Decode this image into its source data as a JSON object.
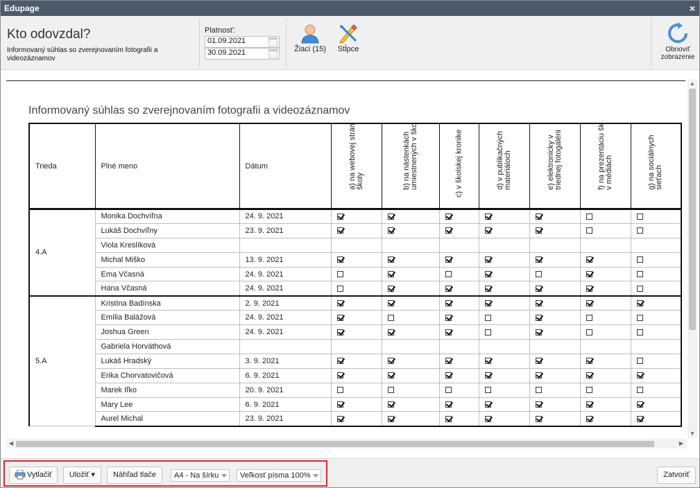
{
  "window": {
    "title": "Edupage",
    "close_glyph": "×"
  },
  "toolbar": {
    "heading": "Kto odovzdal?",
    "subheading": "Informovaný súhlas so zverejnovaním fotografii a videozáznamov",
    "validity_label": "Platnosť:",
    "date_from": "01.09.2021",
    "date_to": "30.09.2021",
    "students_label": "Žiaci (15)",
    "columns_label": "Stĺpce",
    "refresh_label_line1": "Obnoviť",
    "refresh_label_line2": "zobrazenie"
  },
  "report": {
    "title": "Informovaný súhlas so zverejnovaním fotografii a videozáznamov",
    "headers": {
      "class": "Trieda",
      "name": "Plné meno",
      "date": "Dátum",
      "consents": [
        "a) na webovej stránke školy",
        "b) na nástenkách umiestnených v škole",
        "c) v školskej kronike",
        "d) v publikačných materiáloch",
        "e) elektronicky v triednej fotogalérii",
        "f) na prezentáciu školy v médiách",
        "g) na sociálnych sieťach"
      ]
    },
    "groups": [
      {
        "class": "4.A",
        "rows": [
          {
            "name": "Monika Dochvíľna",
            "date": "24. 9. 2021",
            "checks": [
              true,
              true,
              true,
              true,
              true,
              false,
              false
            ]
          },
          {
            "name": "Lukáš Dochvíľny",
            "date": "23. 9. 2021",
            "checks": [
              true,
              true,
              true,
              true,
              true,
              false,
              false
            ]
          },
          {
            "name": "Viola Kreslíková",
            "date": "",
            "checks": null
          },
          {
            "name": "Michal Miško",
            "date": "13. 9. 2021",
            "checks": [
              true,
              true,
              true,
              true,
              true,
              true,
              false
            ]
          },
          {
            "name": "Ema Včasná",
            "date": "24. 9. 2021",
            "checks": [
              false,
              true,
              false,
              true,
              false,
              true,
              false
            ]
          },
          {
            "name": "Hana Včasná",
            "date": "24. 9. 2021",
            "checks": [
              false,
              true,
              true,
              true,
              true,
              true,
              false
            ]
          }
        ]
      },
      {
        "class": "5.A",
        "rows": [
          {
            "name": "Kristína Badínska",
            "date": "2. 9. 2021",
            "checks": [
              true,
              true,
              true,
              true,
              true,
              true,
              true
            ]
          },
          {
            "name": "Emília Balážová",
            "date": "24. 9. 2021",
            "checks": [
              true,
              false,
              true,
              false,
              true,
              false,
              false
            ]
          },
          {
            "name": "Joshua Green",
            "date": "24. 9. 2021",
            "checks": [
              true,
              true,
              true,
              false,
              true,
              false,
              false
            ]
          },
          {
            "name": "Gabriela Horváthová",
            "date": "",
            "checks": null
          },
          {
            "name": "Lukáš Hradský",
            "date": "3. 9. 2021",
            "checks": [
              true,
              true,
              true,
              true,
              true,
              true,
              false
            ]
          },
          {
            "name": "Erika Chorvatovičová",
            "date": "6. 9. 2021",
            "checks": [
              true,
              true,
              true,
              true,
              true,
              true,
              true
            ]
          },
          {
            "name": "Marek Iľko",
            "date": "20. 9. 2021",
            "checks": [
              false,
              false,
              false,
              false,
              false,
              false,
              false
            ]
          },
          {
            "name": "Mary Lee",
            "date": "6. 9. 2021",
            "checks": [
              true,
              true,
              true,
              true,
              true,
              true,
              true
            ]
          },
          {
            "name": "Aurel Michal",
            "date": "23. 9. 2021",
            "checks": [
              true,
              true,
              true,
              true,
              true,
              true,
              true
            ]
          }
        ]
      }
    ]
  },
  "footer": {
    "print_label": "Vytlačiť",
    "save_label": "Uložiť ▾",
    "preview_label": "Náhľad tlače",
    "paper_select": "A4 - Na šírku",
    "font_select": "Veľkosť písma 100%",
    "close_label": "Zatvoriť"
  },
  "colors": {
    "titlebar": "#4a5a6a",
    "highlight_border": "#e0262b",
    "refresh_icon": "#4a90d9"
  },
  "icons": [
    "close-icon",
    "calendar-icon",
    "students-icon",
    "columns-icon",
    "refresh-icon",
    "printer-icon",
    "checkbox-icon"
  ]
}
